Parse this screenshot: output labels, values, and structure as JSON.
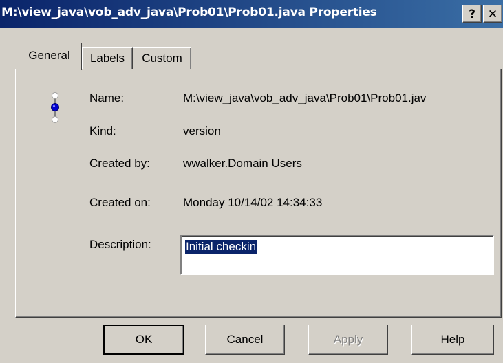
{
  "window": {
    "title": "M:\\view_java\\vob_adv_java\\Prob01\\Prob01.java Properties",
    "help_glyph": "?",
    "close_glyph": "✕"
  },
  "tabs": [
    {
      "label": "General",
      "active": true
    },
    {
      "label": "Labels",
      "active": false
    },
    {
      "label": "Custom",
      "active": false
    }
  ],
  "general": {
    "icon": "version-tree-icon",
    "fields": [
      {
        "label": "Name:",
        "value": "M:\\view_java\\vob_adv_java\\Prob01\\Prob01.jav"
      },
      {
        "label": "Kind:",
        "value": "version"
      },
      {
        "label": "Created by:",
        "value": "wwalker.Domain Users"
      },
      {
        "label": "Created on:",
        "value": "Monday 10/14/02 14:34:33"
      }
    ],
    "description_label": "Description:",
    "description_value": "Initial checkin"
  },
  "buttons": {
    "ok": "OK",
    "cancel": "Cancel",
    "apply": "Apply",
    "help": "Help"
  },
  "colors": {
    "titlebar_start": "#0a246a",
    "titlebar_end": "#3a6ea5",
    "dialog_face": "#d4d0c8",
    "selection": "#0a246a",
    "icon_node": "#0000cc"
  }
}
